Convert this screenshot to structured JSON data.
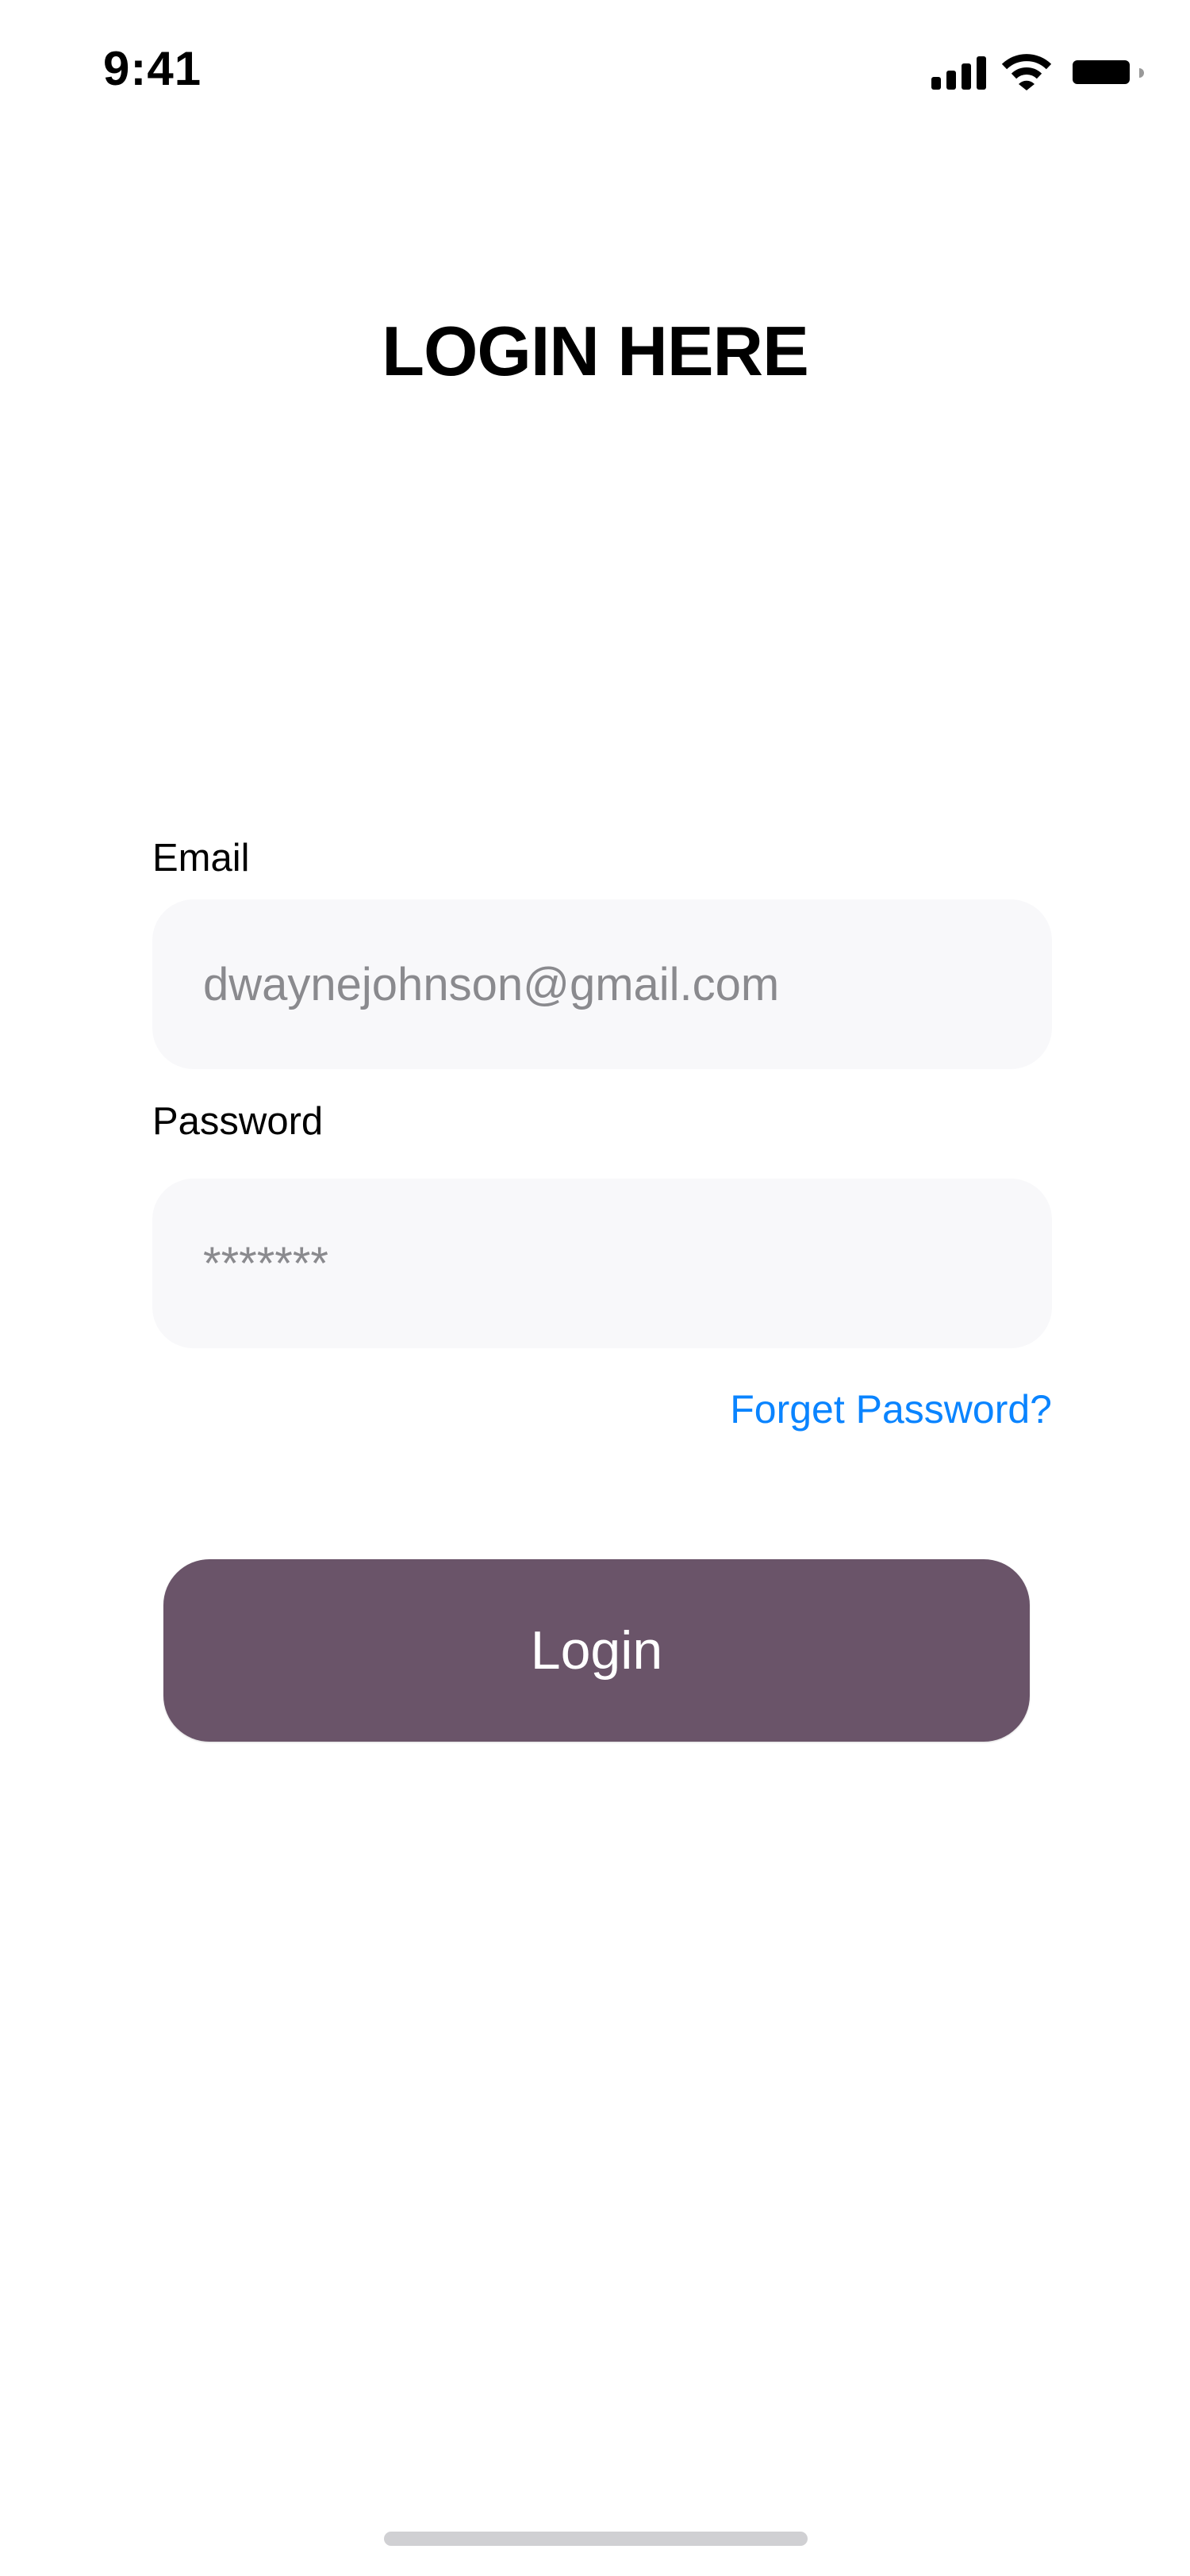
{
  "status_bar": {
    "time": "9:41",
    "icons": [
      "signal-icon",
      "wifi-icon",
      "battery-icon"
    ]
  },
  "title": "LOGIN HERE",
  "form": {
    "email_label": "Email",
    "email_value": "dwaynejohnson@gmail.com",
    "password_label": "Password",
    "password_value": "*******",
    "forget_link": "Forget Password?",
    "login_button": "Login"
  },
  "colors": {
    "accent": "#6a5469",
    "link": "#0a84ff",
    "input_bg": "#f8f8fa"
  }
}
